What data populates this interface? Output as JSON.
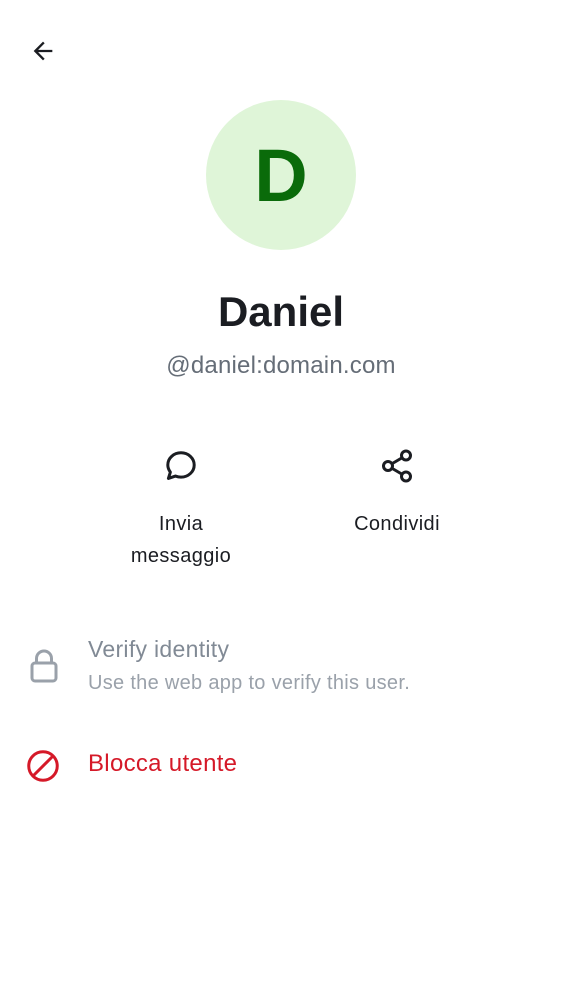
{
  "header": {
    "back_icon": "arrow-left-icon"
  },
  "profile": {
    "avatar_initial": "D",
    "avatar_bg": "#dff5d8",
    "avatar_fg": "#0a6b0a",
    "display_name": "Daniel",
    "user_id": "@daniel:domain.com"
  },
  "actions": {
    "message": {
      "icon": "chat-bubble-icon",
      "label_line1": "Invia",
      "label_line2": "messaggio"
    },
    "share": {
      "icon": "share-icon",
      "label": "Condividi"
    }
  },
  "verify": {
    "icon": "lock-icon",
    "title": "Verify identity",
    "subtitle": "Use the web app to verify this user."
  },
  "block": {
    "icon": "block-icon",
    "label": "Blocca utente",
    "color": "#d51928"
  }
}
